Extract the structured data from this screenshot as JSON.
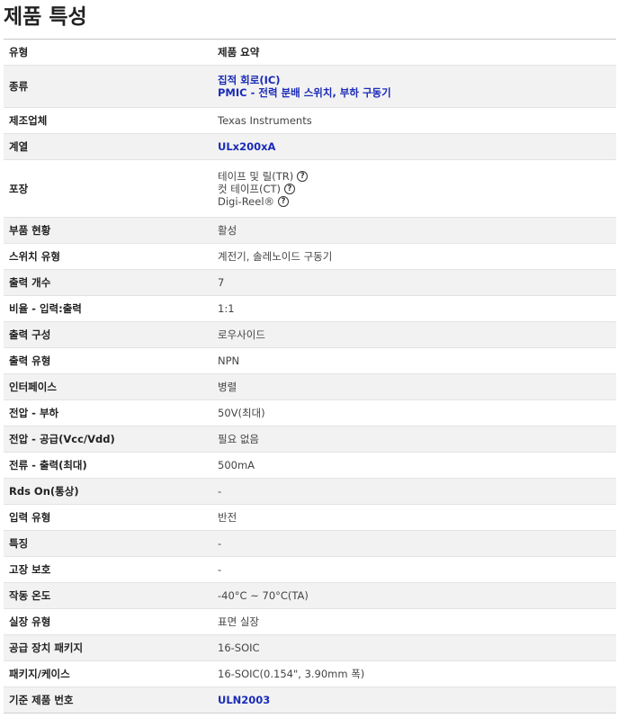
{
  "page_title": "제품 특성",
  "header": {
    "type_label": "유형",
    "summary_label": "제품 요약"
  },
  "rows": [
    {
      "key": "종류",
      "values": [
        "집적 회로(IC)",
        "PMIC - 전력 분배 스위치, 부하 구동기"
      ],
      "link": true
    },
    {
      "key": "제조업체",
      "values": [
        "Texas Instruments"
      ]
    },
    {
      "key": "계열",
      "values": [
        "ULx200xA"
      ],
      "link": true
    },
    {
      "key": "포장",
      "values": [
        "테이프 및 릴(TR)",
        "컷 테이프(CT)",
        "Digi-Reel®"
      ],
      "help_icon": "question-circle-icon"
    },
    {
      "key": "부품 현황",
      "values": [
        "활성"
      ]
    },
    {
      "key": "스위치 유형",
      "values": [
        "계전기, 솔레노이드 구동기"
      ]
    },
    {
      "key": "출력 개수",
      "values": [
        "7"
      ]
    },
    {
      "key": "비율 - 입력:출력",
      "values": [
        "1:1"
      ]
    },
    {
      "key": "출력 구성",
      "values": [
        "로우사이드"
      ]
    },
    {
      "key": "출력 유형",
      "values": [
        "NPN"
      ]
    },
    {
      "key": "인터페이스",
      "values": [
        "병렬"
      ]
    },
    {
      "key": "전압 - 부하",
      "values": [
        "50V(최대)"
      ]
    },
    {
      "key": "전압 - 공급(Vcc/Vdd)",
      "values": [
        "필요 없음"
      ]
    },
    {
      "key": "전류 - 출력(최대)",
      "values": [
        "500mA"
      ]
    },
    {
      "key": "Rds On(통상)",
      "values": [
        "-"
      ]
    },
    {
      "key": "입력 유형",
      "values": [
        "반전"
      ]
    },
    {
      "key": "특징",
      "values": [
        "-"
      ]
    },
    {
      "key": "고장 보호",
      "values": [
        "-"
      ]
    },
    {
      "key": "작동 온도",
      "values": [
        "-40°C ~ 70°C(TA)"
      ]
    },
    {
      "key": "실장 유형",
      "values": [
        "표면 실장"
      ]
    },
    {
      "key": "공급 장치 패키지",
      "values": [
        "16-SOIC"
      ]
    },
    {
      "key": "패키지/케이스",
      "values": [
        "16-SOIC(0.154\", 3.90mm 폭)"
      ]
    },
    {
      "key": "기준 제품 번호",
      "values": [
        "ULN2003"
      ],
      "link": true
    }
  ]
}
